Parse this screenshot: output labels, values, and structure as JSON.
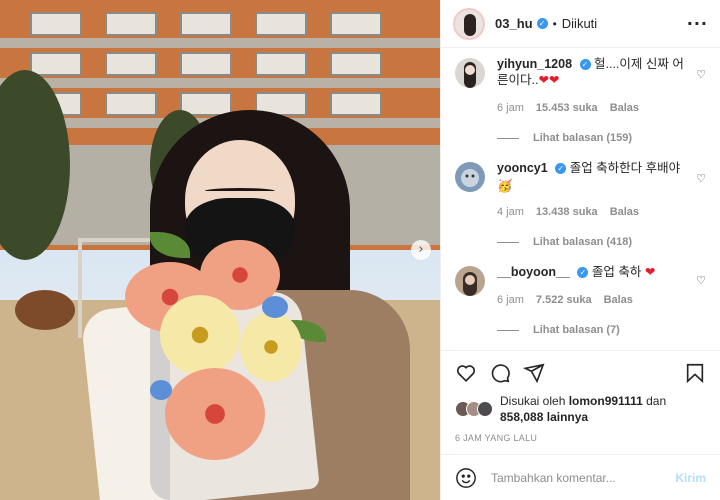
{
  "post": {
    "username": "03_hu",
    "follow_status": "Diikuti",
    "dot": "•",
    "more": "···",
    "next_arrow": "›"
  },
  "comments": [
    {
      "user": "yihyun_1208",
      "text": "헐....이제 신짜 어른이다..",
      "hearts": "❤❤",
      "age": "6 jam",
      "likes": "15.453 suka",
      "reply": "Balas",
      "view_replies": "Lihat balasan (159)",
      "avatar_color": "#dad6d2"
    },
    {
      "user": "yooncy1",
      "text": "졸업 축하한다 후배야",
      "hearts": "🥳",
      "age": "4 jam",
      "likes": "13.438 suka",
      "reply": "Balas",
      "view_replies": "Lihat balasan (418)",
      "avatar_color": "#7f9ab8"
    },
    {
      "user": "__boyoon__",
      "text": "졸업 축하",
      "hearts": "❤",
      "age": "6 jam",
      "likes": "7.522 suka",
      "reply": "Balas",
      "view_replies": "Lihat balasan (7)",
      "avatar_color": "#b9a58f"
    }
  ],
  "likes": {
    "prefix": "Disukai oleh",
    "user": "lomon991111",
    "joiner": "dan",
    "count": "858,088",
    "suffix": "lainnya"
  },
  "timestamp": "6 JAM YANG LALU",
  "comment_box": {
    "placeholder": "Tambahkan komentar...",
    "post_label": "Kirim"
  },
  "colors": {
    "verified": "#3897f0",
    "secondary_text": "#8e8e8e",
    "heart": "#e0202f",
    "post_disabled": "#b2dffc"
  },
  "icons": [
    "heart-icon",
    "comment-icon",
    "share-icon",
    "bookmark-icon",
    "emoji-icon",
    "more-icon",
    "verified-icon",
    "chevron-right-icon"
  ]
}
